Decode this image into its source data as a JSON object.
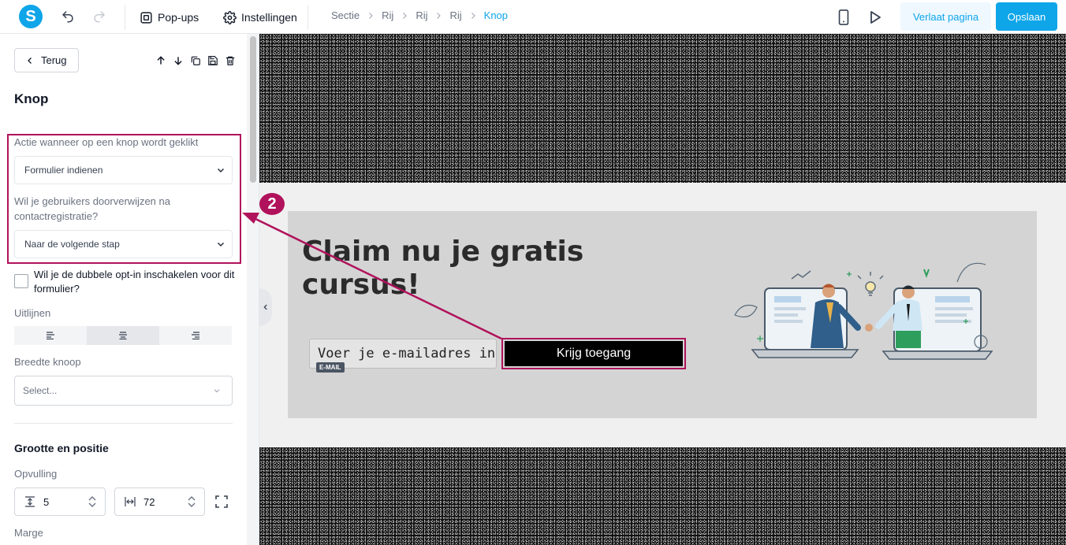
{
  "topbar": {
    "logo_letter": "S",
    "popups_label": "Pop-ups",
    "settings_label": "Instellingen",
    "breadcrumbs": [
      "Sectie",
      "Rij",
      "Rij",
      "Rij",
      "Knop"
    ],
    "leave_label": "Verlaat pagina",
    "save_label": "Opslaan",
    "accent_color": "#0ea5e9"
  },
  "sidebar": {
    "back_label": "Terug",
    "title": "Knop",
    "action_label": "Actie wanneer op een knop wordt geklikt",
    "action_value": "Formulier indienen",
    "redirect_label": "Wil je gebruikers doorverwijzen na contactregistratie?",
    "redirect_value": "Naar de volgende stap",
    "double_optin_label": "Wil je de dubbele opt-in inschakelen voor dit formulier?",
    "double_optin_checked": false,
    "align_label": "Uitlijnen",
    "align_selected": "center",
    "width_label": "Breedte knoop",
    "width_placeholder": "Select...",
    "size_section_title": "Grootte en positie",
    "padding_label": "Opvulling",
    "padding_vertical": "5",
    "padding_horizontal": "72",
    "margin_label": "Marge"
  },
  "canvas": {
    "headline": "Claim nu je gratis cursus!",
    "email_placeholder": "Voer je e-mailadres in",
    "email_badge": "E-MAIL",
    "cta_label": "Krijg toegang"
  },
  "annotation": {
    "step_number": "2",
    "color": "#b0125b"
  }
}
